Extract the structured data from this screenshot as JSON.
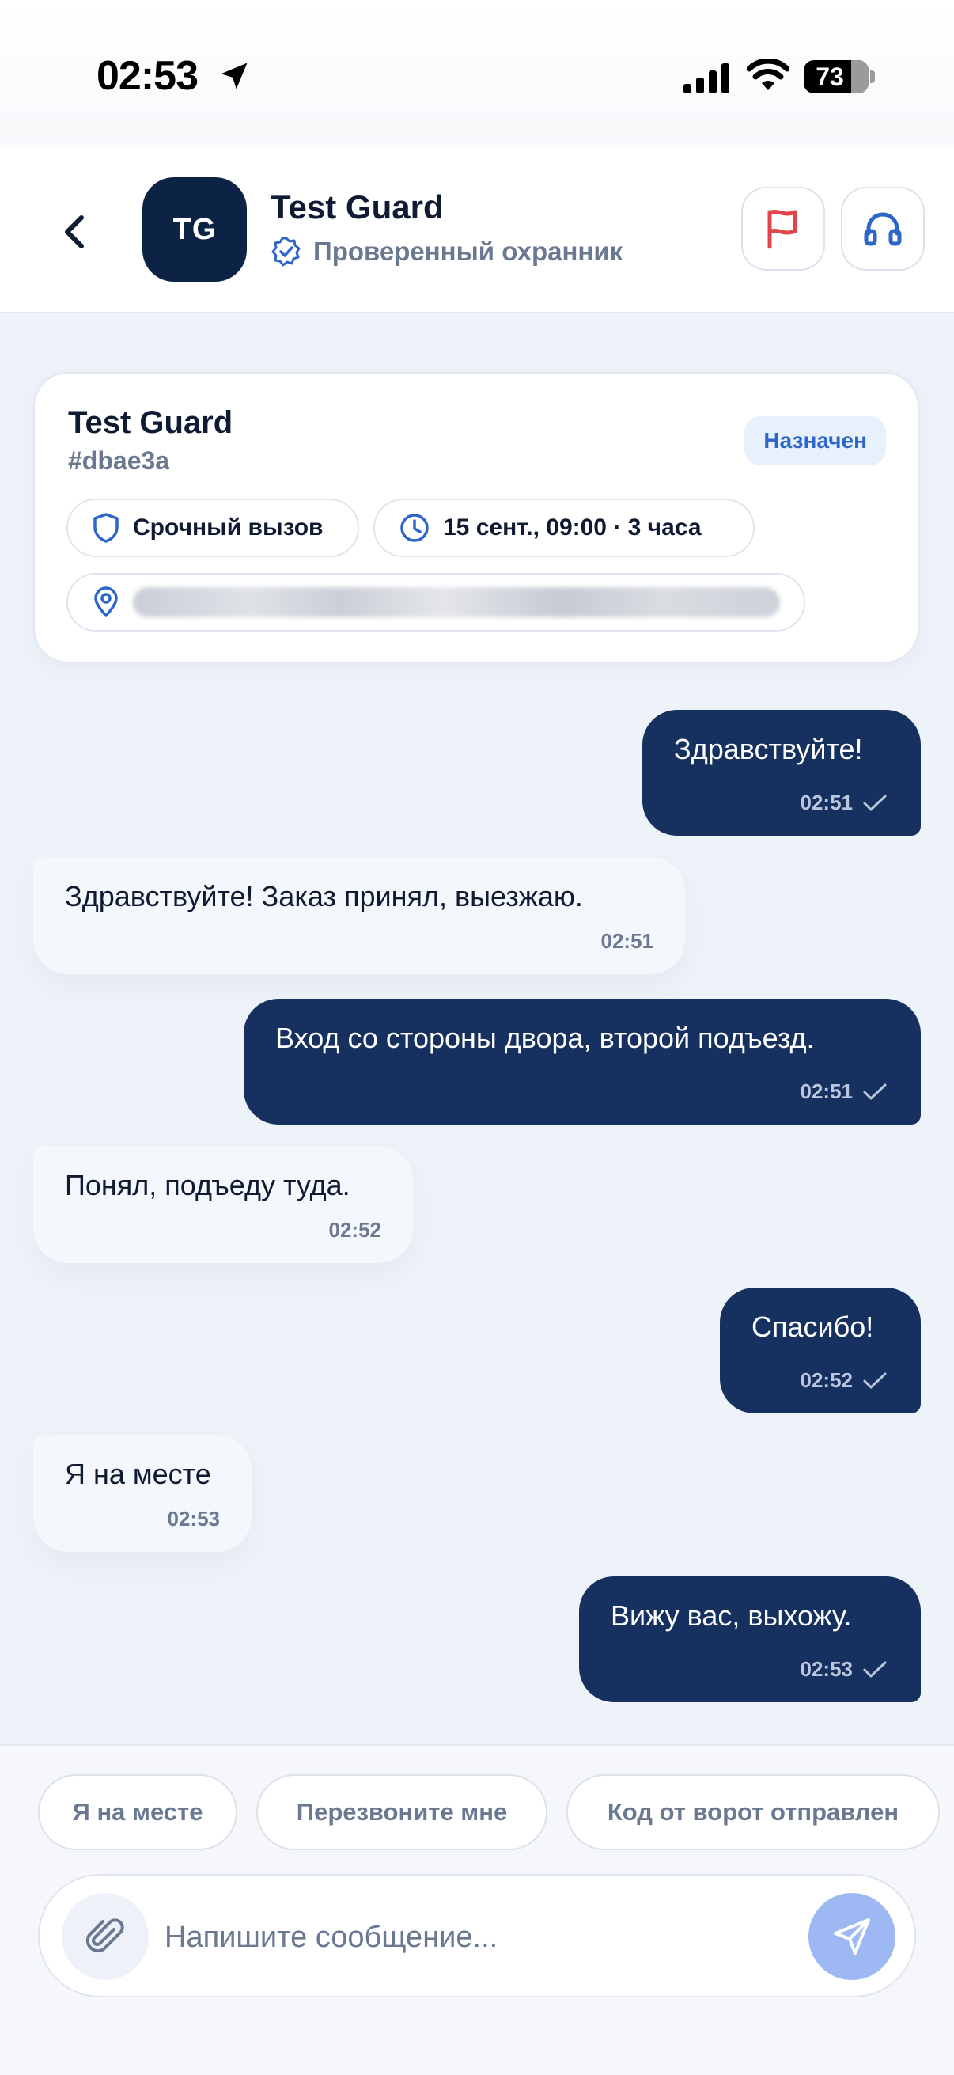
{
  "status_bar": {
    "time": "02:53",
    "battery": "73",
    "battery_level": 0.73
  },
  "header": {
    "avatar_initials": "TG",
    "name": "Test Guard",
    "verified_label": "Проверенный охранник"
  },
  "order_card": {
    "name": "Test Guard",
    "id": "#dbae3a",
    "status": "Назначен",
    "urgency": "Срочный вызов",
    "schedule": "15 сент., 09:00 · 3 часа"
  },
  "messages": [
    {
      "direction": "out",
      "text": "Здравствуйте!",
      "time": "02:51"
    },
    {
      "direction": "in",
      "text": "Здравствуйте! Заказ принял, выезжаю.",
      "time": "02:51"
    },
    {
      "direction": "out",
      "text": "Вход со стороны двора, второй подъезд.",
      "time": "02:51"
    },
    {
      "direction": "in",
      "text": "Понял, подъеду туда.",
      "time": "02:52"
    },
    {
      "direction": "out",
      "text": "Спасибо!",
      "time": "02:52"
    },
    {
      "direction": "in",
      "text": "Я на месте",
      "time": "02:53"
    },
    {
      "direction": "out",
      "text": "Вижу вас, выхожу.",
      "time": "02:53"
    }
  ],
  "quick_replies": [
    "Я на месте",
    "Перезвоните мне",
    "Код от ворот отправлен"
  ],
  "composer": {
    "placeholder": "Напишите сообщение..."
  },
  "colors": {
    "accent": "#16305f",
    "avatar_bg": "#0d2345",
    "badge_text": "#2d66c9",
    "flag": "#e0454a",
    "support_icon": "#2d66c9",
    "send_button": "#9db8f2"
  },
  "icons": [
    "location-arrow-icon",
    "signal-icon",
    "wifi-icon",
    "battery-icon",
    "chevron-left-icon",
    "verified-badge-icon",
    "flag-icon",
    "headset-icon",
    "shield-icon",
    "clock-icon",
    "map-pin-icon",
    "check-icon",
    "paperclip-icon",
    "send-icon"
  ]
}
